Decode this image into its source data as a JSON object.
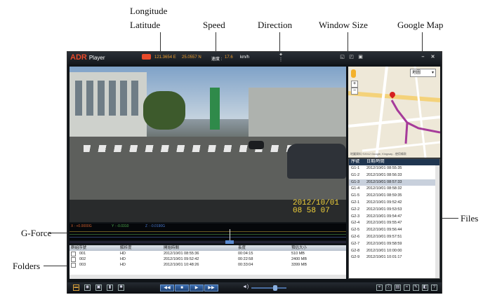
{
  "annotations": {
    "longitude": "Longitude",
    "latitude": "Latitude",
    "speed": "Speed",
    "direction": "Direction",
    "window_size": "Window Size",
    "google_map": "Google Map",
    "files": "Files",
    "g_force": "G-Force",
    "folders": "Folders"
  },
  "player": {
    "app_name": "ADR",
    "app_sub": "Player",
    "longitude": "121.3654 E",
    "latitude": "25.0557 N",
    "speed_label": "速度 :",
    "speed_value": "17.6",
    "speed_unit": "km/h",
    "video_date": "2012/10/01",
    "video_time": "08 58 07",
    "map_type": "地圖",
    "map_copyright": "地圖資料 ©2012 Google, Kingway - 使用條款",
    "files_header": {
      "col1": "序號",
      "col2": "日期/時間"
    },
    "files": [
      {
        "id": "G1-1",
        "dt": "2012/10/01 08:55:35"
      },
      {
        "id": "G1-2",
        "dt": "2012/10/01 08:56:33"
      },
      {
        "id": "G1-3",
        "dt": "2012/10/01 08:57:33"
      },
      {
        "id": "G1-4",
        "dt": "2012/10/01 08:58:32"
      },
      {
        "id": "G1-5",
        "dt": "2012/10/01 08:59:35"
      },
      {
        "id": "G2-1",
        "dt": "2012/10/01 09:52:42"
      },
      {
        "id": "G2-2",
        "dt": "2012/10/01 09:53:53"
      },
      {
        "id": "G2-3",
        "dt": "2012/10/01 09:54:47"
      },
      {
        "id": "G2-4",
        "dt": "2012/10/01 09:55:47"
      },
      {
        "id": "G2-5",
        "dt": "2012/10/01 09:56:44"
      },
      {
        "id": "G2-6",
        "dt": "2012/10/01 09:57:51"
      },
      {
        "id": "G2-7",
        "dt": "2012/10/01 09:58:59"
      },
      {
        "id": "G2-8",
        "dt": "2012/10/01 10:00:00"
      },
      {
        "id": "G2-9",
        "dt": "2012/10/01 10:01:17"
      }
    ],
    "selected_file_index": 2,
    "gforce": {
      "x": "X : +0.0000G",
      "y": "Y : -0.0310",
      "z": "Z : -0.0190G"
    },
    "folders_header": {
      "group": "群組序號",
      "res": "解析度",
      "start": "開始時間",
      "length": "長度",
      "size": "預估大小"
    },
    "folders": [
      {
        "group": "001",
        "res": "HD",
        "start": "2012/10/01 08:55:36",
        "length": "00:04:15",
        "size": "510 MB"
      },
      {
        "group": "002",
        "res": "HD",
        "start": "2012/10/01 09:52:42",
        "length": "00:22:58",
        "size": "2400 MB"
      },
      {
        "group": "003",
        "res": "HD",
        "start": "2012/10/01 10:48:26",
        "length": "00:33:04",
        "size": "3399 MB"
      }
    ],
    "volume_level": 0.7
  }
}
